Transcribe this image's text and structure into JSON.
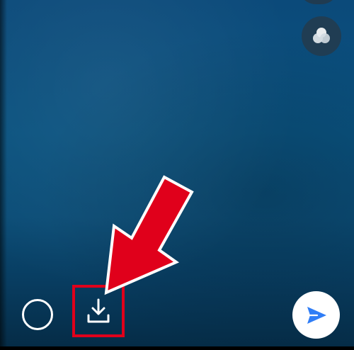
{
  "screen": {
    "background_colors": [
      "#0b4a7a",
      "#0a527f",
      "#083d61",
      "#052b45"
    ]
  },
  "controls": {
    "top_button_icon": "partial-circle-icon",
    "filters_icon": "filters-icon",
    "shutter_icon": "shutter-circle-icon",
    "download_icon": "download-icon",
    "send_icon": "send-icon"
  },
  "annotation": {
    "highlight_color": "#e0001b",
    "arrow_color": "#e0001b",
    "arrow_outline_color": "#ffffff"
  }
}
